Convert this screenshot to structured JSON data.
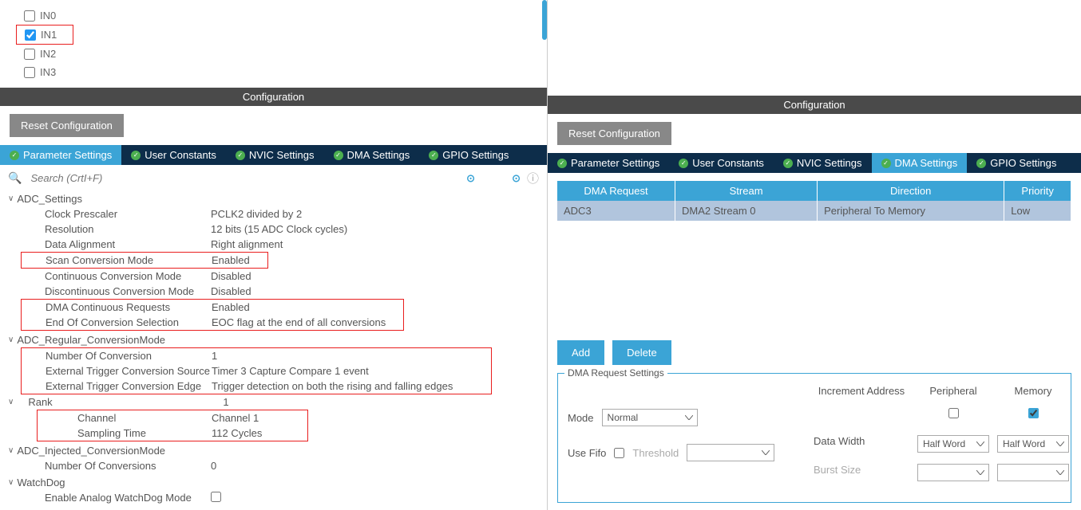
{
  "left": {
    "channels": [
      {
        "label": "IN0",
        "checked": false,
        "red": false
      },
      {
        "label": "IN1",
        "checked": true,
        "red": true
      },
      {
        "label": "IN2",
        "checked": false,
        "red": false
      },
      {
        "label": "IN3",
        "checked": false,
        "red": false
      }
    ],
    "config_header": "Configuration",
    "reset_label": "Reset Configuration",
    "tabs": [
      "Parameter Settings",
      "User Constants",
      "NVIC Settings",
      "DMA Settings",
      "GPIO Settings"
    ],
    "active_tab": 0,
    "search_placeholder": "Search (CrtI+F)",
    "sections": {
      "adc_settings": {
        "title": "ADC_Settings",
        "rows": [
          {
            "label": "Clock Prescaler",
            "value": "PCLK2 divided by 2"
          },
          {
            "label": "Resolution",
            "value": "12 bits (15 ADC Clock cycles)"
          },
          {
            "label": "Data Alignment",
            "value": "Right alignment"
          },
          {
            "label": "Scan Conversion Mode",
            "value": "Enabled",
            "red": "single"
          },
          {
            "label": "Continuous Conversion Mode",
            "value": "Disabled"
          },
          {
            "label": "Discontinuous Conversion Mode",
            "value": "Disabled"
          },
          {
            "label": "DMA Continuous Requests",
            "value": "Enabled",
            "red": "group_start"
          },
          {
            "label": "End Of Conversion Selection",
            "value": "EOC flag at the end of all conversions",
            "red": "group_end"
          }
        ]
      },
      "adc_regular": {
        "title": "ADC_Regular_ConversionMode",
        "rows": [
          {
            "label": "Number Of Conversion",
            "value": "1",
            "red": "group_start"
          },
          {
            "label": "External Trigger Conversion Source",
            "value": "Timer 3 Capture Compare 1 event"
          },
          {
            "label": "External Trigger Conversion Edge",
            "value": "Trigger detection on both the rising and falling edges",
            "red": "group_end"
          }
        ],
        "rank": {
          "title": "Rank",
          "value": "1",
          "rows": [
            {
              "label": "Channel",
              "value": "Channel 1"
            },
            {
              "label": "Sampling Time",
              "value": "112 Cycles"
            }
          ]
        }
      },
      "adc_injected": {
        "title": "ADC_Injected_ConversionMode",
        "rows": [
          {
            "label": "Number Of Conversions",
            "value": "0"
          }
        ]
      },
      "watchdog": {
        "title": "WatchDog",
        "rows": [
          {
            "label": "Enable Analog WatchDog Mode",
            "value": "",
            "checkbox": true
          }
        ]
      }
    }
  },
  "right": {
    "config_header": "Configuration",
    "reset_label": "Reset Configuration",
    "tabs": [
      "Parameter Settings",
      "User Constants",
      "NVIC Settings",
      "DMA Settings",
      "GPIO Settings"
    ],
    "active_tab": 3,
    "table": {
      "headers": [
        "DMA Request",
        "Stream",
        "Direction",
        "Priority"
      ],
      "row": [
        "ADC3",
        "DMA2 Stream 0",
        "Peripheral To Memory",
        "Low"
      ]
    },
    "add_label": "Add",
    "delete_label": "Delete",
    "dma_settings": {
      "legend": "DMA Request Settings",
      "headers": {
        "peripheral": "Peripheral",
        "memory": "Memory"
      },
      "mode_label": "Mode",
      "mode_value": "Normal",
      "increment_label": "Increment Address",
      "increment_peripheral": false,
      "increment_memory": true,
      "use_fifo_label": "Use Fifo",
      "use_fifo_checked": false,
      "threshold_label": "Threshold",
      "threshold_value": "",
      "data_width_label": "Data Width",
      "data_width_peripheral": "Half Word",
      "data_width_memory": "Half Word",
      "burst_size_label": "Burst Size",
      "burst_size_peripheral": "",
      "burst_size_memory": ""
    }
  }
}
